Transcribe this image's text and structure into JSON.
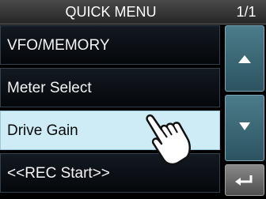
{
  "header": {
    "title": "QUICK MENU",
    "page": "1/1"
  },
  "menu": {
    "items": [
      {
        "label": "VFO/MEMORY",
        "selected": false
      },
      {
        "label": "Meter Select",
        "selected": false
      },
      {
        "label": "Drive Gain",
        "selected": true
      },
      {
        "label": "<<REC Start>>",
        "selected": false
      }
    ]
  },
  "side_buttons": {
    "up_icon": "triangle-up-icon",
    "down_icon": "triangle-down-icon",
    "back_icon": "return-arrow-icon"
  },
  "pointer": {
    "icon": "hand-pointer-icon"
  },
  "colors": {
    "selected_bg": "#cdecf6",
    "button_blue": "#3c6a78",
    "header_bg": "#333333"
  }
}
